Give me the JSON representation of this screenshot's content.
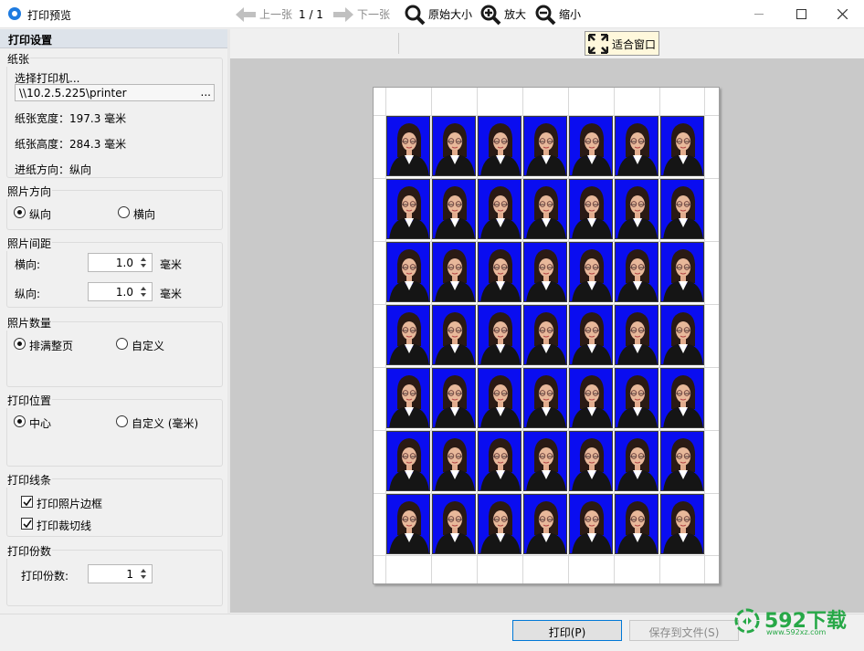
{
  "window": {
    "title": "打印预览"
  },
  "sidebar": {
    "header": "打印设置",
    "paper": {
      "title": "纸张",
      "select_printer": "选择打印机...",
      "printer": "\\\\10.2.5.225\\printer",
      "browse": "...",
      "width": "纸张宽度：197.3 毫米",
      "height": "纸张高度：284.3 毫米",
      "feed": "进纸方向：纵向"
    },
    "orientation": {
      "title": "照片方向",
      "portrait": "纵向",
      "landscape": "横向"
    },
    "spacing": {
      "title": "照片间距",
      "horizontal_label": "横向:",
      "horizontal_value": "1.0",
      "horizontal_unit": "毫米",
      "vertical_label": "纵向:",
      "vertical_value": "1.0",
      "vertical_unit": "毫米"
    },
    "count": {
      "title": "照片数量",
      "fill_page": "排满整页",
      "custom": "自定义"
    },
    "position": {
      "title": "打印位置",
      "center": "中心",
      "custom": "自定义 (毫米)"
    },
    "lines": {
      "title": "打印线条",
      "border": "打印照片边框",
      "cut_lines": "打印裁切线"
    },
    "copies": {
      "title": "打印份数",
      "label": "打印份数:",
      "value": "1"
    }
  },
  "toolbar": {
    "prev": "上一张",
    "page": "1 / 1",
    "next": "下一张",
    "original": "原始大小",
    "zoom_in": "放大",
    "zoom_out": "缩小",
    "fit": "适合窗口"
  },
  "footer": {
    "print": "打印(P)",
    "save": "保存到文件(S)"
  },
  "watermark": {
    "brand": "592下载",
    "url": "www.592xz.com"
  },
  "colors": {
    "photo_background": "#0a0df0",
    "accent": "#0078d7"
  }
}
